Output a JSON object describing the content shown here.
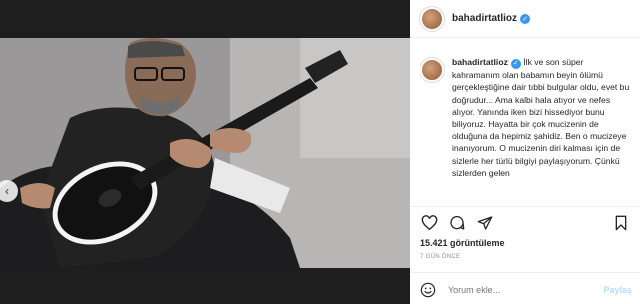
{
  "post": {
    "username": "bahadirtatlioz",
    "caption": "İlk ve son süper kahramanım olan babamın beyin ölümü gerçekleştiğine dair tıbbi bulgular oldu, evet bu doğrudur... Ama kalbi hala atıyor ve nefes alıyor. Yanında iken bizi hissediyor bunu biliyoruz. Hayatta bir çok mucizenin de olduğuna da hepimiz şahidiz. Ben o mucizeye inanıyorum. O mucizenin diri kalması için de sizlerle her türlü bilgiyi paylaşıyorum. Çünkü sizlerden gelen",
    "views": "15.421 görüntüleme",
    "time_ago": "7 GÜN ÖNCE"
  },
  "comment": {
    "placeholder": "Yorum ekle...",
    "post_label": "Paylaş"
  },
  "icons": {
    "like": "heart-icon",
    "comment": "comment-icon",
    "share": "share-icon",
    "save": "bookmark-icon",
    "emoji": "smiley-icon",
    "mute": "mute-icon",
    "prev": "chevron-left-icon"
  },
  "colors": {
    "verified": "#3897f0",
    "post_button": "#b2dffc"
  }
}
